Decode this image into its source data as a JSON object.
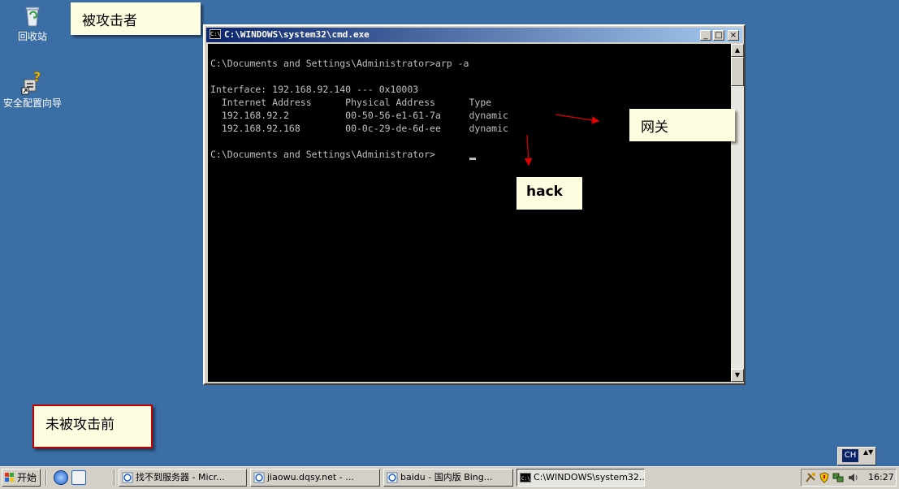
{
  "desktop": {
    "icons": [
      {
        "label": "回收站",
        "icon": "recycle-bin-icon"
      },
      {
        "label": "安全配置向导",
        "icon": "security-wizard-icon"
      }
    ]
  },
  "callouts": {
    "victim": "被攻击者",
    "gateway": "网关",
    "hack": "hack",
    "before": "未被攻击前"
  },
  "cmd_window": {
    "title": "C:\\WINDOWS\\system32\\cmd.exe",
    "icon_text": "C:\\",
    "buttons": {
      "minimize": "_",
      "maximize": "□",
      "close": "×"
    },
    "lines": [
      "",
      "C:\\Documents and Settings\\Administrator>arp -a",
      "",
      "Interface: 192.168.92.140 --- 0x10003",
      "  Internet Address      Physical Address      Type",
      "  192.168.92.2          00-50-56-e1-61-7a     dynamic",
      "  192.168.92.168        00-0c-29-de-6d-ee     dynamic",
      "",
      "C:\\Documents and Settings\\Administrator>"
    ],
    "scroll_up": "▲",
    "scroll_down": "▼"
  },
  "langbar": {
    "lang": "CH",
    "options": "▲▼"
  },
  "taskbar": {
    "start_label": "开始",
    "items": [
      {
        "label": "找不到服务器 - Micr...",
        "icon": "ie-icon",
        "active": false
      },
      {
        "label": "jiaowu.dqsy.net - ...",
        "icon": "ie-icon",
        "active": false
      },
      {
        "label": "baidu - 国内版 Bing...",
        "icon": "ie-icon",
        "active": false
      },
      {
        "label": "C:\\WINDOWS\\system32...",
        "icon": "cmd-icon",
        "active": true
      }
    ],
    "clock": "16:27"
  },
  "colors": {
    "desktop": "#3a6ea5",
    "titlebar_start": "#0a246a",
    "titlebar_end": "#a6caf0",
    "callout_bg": "#fffde0",
    "arrow": "#e00000"
  }
}
